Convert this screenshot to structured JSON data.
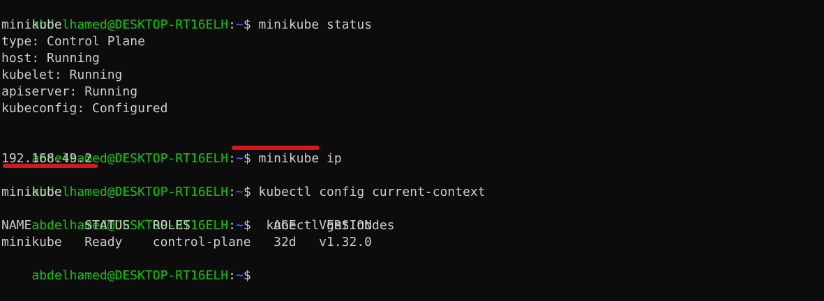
{
  "colors": {
    "background": "#0c0c0c",
    "text": "#cccccc",
    "prompt_user": "#16c60c",
    "prompt_path": "#3b78ff",
    "annotation_underline": "#d21a1a"
  },
  "prompt": {
    "user_host": "abdelhamed@DESKTOP-RT16ELH",
    "colon": ":",
    "path": "~",
    "symbol": "$"
  },
  "commands": [
    {
      "text": " minikube status"
    },
    {
      "text": " minikube ip"
    },
    {
      "text": " kubectl config current-context"
    },
    {
      "text": "  kubectl get nodes"
    },
    {
      "text": ""
    }
  ],
  "outputs": {
    "status": [
      "minikube",
      "type: Control Plane",
      "host: Running",
      "kubelet: Running",
      "apiserver: Running",
      "kubeconfig: Configured"
    ],
    "ip": "192.168.49.2",
    "context": "minikube",
    "nodes_header": "NAME       STATUS   ROLES           AGE   VERSION",
    "nodes_row": "minikube   Ready    control-plane   32d   v1.32.0"
  }
}
